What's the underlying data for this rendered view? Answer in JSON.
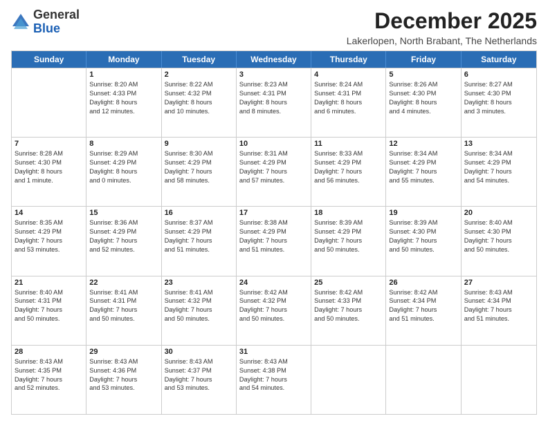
{
  "logo": {
    "general": "General",
    "blue": "Blue"
  },
  "title": "December 2025",
  "location": "Lakerlopen, North Brabant, The Netherlands",
  "header_days": [
    "Sunday",
    "Monday",
    "Tuesday",
    "Wednesday",
    "Thursday",
    "Friday",
    "Saturday"
  ],
  "weeks": [
    [
      {
        "empty": true
      },
      {
        "day": "1",
        "sunrise": "Sunrise: 8:20 AM",
        "sunset": "Sunset: 4:33 PM",
        "daylight": "Daylight: 8 hours",
        "minutes": "and 12 minutes."
      },
      {
        "day": "2",
        "sunrise": "Sunrise: 8:22 AM",
        "sunset": "Sunset: 4:32 PM",
        "daylight": "Daylight: 8 hours",
        "minutes": "and 10 minutes."
      },
      {
        "day": "3",
        "sunrise": "Sunrise: 8:23 AM",
        "sunset": "Sunset: 4:31 PM",
        "daylight": "Daylight: 8 hours",
        "minutes": "and 8 minutes."
      },
      {
        "day": "4",
        "sunrise": "Sunrise: 8:24 AM",
        "sunset": "Sunset: 4:31 PM",
        "daylight": "Daylight: 8 hours",
        "minutes": "and 6 minutes."
      },
      {
        "day": "5",
        "sunrise": "Sunrise: 8:26 AM",
        "sunset": "Sunset: 4:30 PM",
        "daylight": "Daylight: 8 hours",
        "minutes": "and 4 minutes."
      },
      {
        "day": "6",
        "sunrise": "Sunrise: 8:27 AM",
        "sunset": "Sunset: 4:30 PM",
        "daylight": "Daylight: 8 hours",
        "minutes": "and 3 minutes."
      }
    ],
    [
      {
        "day": "7",
        "sunrise": "Sunrise: 8:28 AM",
        "sunset": "Sunset: 4:30 PM",
        "daylight": "Daylight: 8 hours",
        "minutes": "and 1 minute."
      },
      {
        "day": "8",
        "sunrise": "Sunrise: 8:29 AM",
        "sunset": "Sunset: 4:29 PM",
        "daylight": "Daylight: 8 hours",
        "minutes": "and 0 minutes."
      },
      {
        "day": "9",
        "sunrise": "Sunrise: 8:30 AM",
        "sunset": "Sunset: 4:29 PM",
        "daylight": "Daylight: 7 hours",
        "minutes": "and 58 minutes."
      },
      {
        "day": "10",
        "sunrise": "Sunrise: 8:31 AM",
        "sunset": "Sunset: 4:29 PM",
        "daylight": "Daylight: 7 hours",
        "minutes": "and 57 minutes."
      },
      {
        "day": "11",
        "sunrise": "Sunrise: 8:33 AM",
        "sunset": "Sunset: 4:29 PM",
        "daylight": "Daylight: 7 hours",
        "minutes": "and 56 minutes."
      },
      {
        "day": "12",
        "sunrise": "Sunrise: 8:34 AM",
        "sunset": "Sunset: 4:29 PM",
        "daylight": "Daylight: 7 hours",
        "minutes": "and 55 minutes."
      },
      {
        "day": "13",
        "sunrise": "Sunrise: 8:34 AM",
        "sunset": "Sunset: 4:29 PM",
        "daylight": "Daylight: 7 hours",
        "minutes": "and 54 minutes."
      }
    ],
    [
      {
        "day": "14",
        "sunrise": "Sunrise: 8:35 AM",
        "sunset": "Sunset: 4:29 PM",
        "daylight": "Daylight: 7 hours",
        "minutes": "and 53 minutes."
      },
      {
        "day": "15",
        "sunrise": "Sunrise: 8:36 AM",
        "sunset": "Sunset: 4:29 PM",
        "daylight": "Daylight: 7 hours",
        "minutes": "and 52 minutes."
      },
      {
        "day": "16",
        "sunrise": "Sunrise: 8:37 AM",
        "sunset": "Sunset: 4:29 PM",
        "daylight": "Daylight: 7 hours",
        "minutes": "and 51 minutes."
      },
      {
        "day": "17",
        "sunrise": "Sunrise: 8:38 AM",
        "sunset": "Sunset: 4:29 PM",
        "daylight": "Daylight: 7 hours",
        "minutes": "and 51 minutes."
      },
      {
        "day": "18",
        "sunrise": "Sunrise: 8:39 AM",
        "sunset": "Sunset: 4:29 PM",
        "daylight": "Daylight: 7 hours",
        "minutes": "and 50 minutes."
      },
      {
        "day": "19",
        "sunrise": "Sunrise: 8:39 AM",
        "sunset": "Sunset: 4:30 PM",
        "daylight": "Daylight: 7 hours",
        "minutes": "and 50 minutes."
      },
      {
        "day": "20",
        "sunrise": "Sunrise: 8:40 AM",
        "sunset": "Sunset: 4:30 PM",
        "daylight": "Daylight: 7 hours",
        "minutes": "and 50 minutes."
      }
    ],
    [
      {
        "day": "21",
        "sunrise": "Sunrise: 8:40 AM",
        "sunset": "Sunset: 4:31 PM",
        "daylight": "Daylight: 7 hours",
        "minutes": "and 50 minutes."
      },
      {
        "day": "22",
        "sunrise": "Sunrise: 8:41 AM",
        "sunset": "Sunset: 4:31 PM",
        "daylight": "Daylight: 7 hours",
        "minutes": "and 50 minutes."
      },
      {
        "day": "23",
        "sunrise": "Sunrise: 8:41 AM",
        "sunset": "Sunset: 4:32 PM",
        "daylight": "Daylight: 7 hours",
        "minutes": "and 50 minutes."
      },
      {
        "day": "24",
        "sunrise": "Sunrise: 8:42 AM",
        "sunset": "Sunset: 4:32 PM",
        "daylight": "Daylight: 7 hours",
        "minutes": "and 50 minutes."
      },
      {
        "day": "25",
        "sunrise": "Sunrise: 8:42 AM",
        "sunset": "Sunset: 4:33 PM",
        "daylight": "Daylight: 7 hours",
        "minutes": "and 50 minutes."
      },
      {
        "day": "26",
        "sunrise": "Sunrise: 8:42 AM",
        "sunset": "Sunset: 4:34 PM",
        "daylight": "Daylight: 7 hours",
        "minutes": "and 51 minutes."
      },
      {
        "day": "27",
        "sunrise": "Sunrise: 8:43 AM",
        "sunset": "Sunset: 4:34 PM",
        "daylight": "Daylight: 7 hours",
        "minutes": "and 51 minutes."
      }
    ],
    [
      {
        "day": "28",
        "sunrise": "Sunrise: 8:43 AM",
        "sunset": "Sunset: 4:35 PM",
        "daylight": "Daylight: 7 hours",
        "minutes": "and 52 minutes."
      },
      {
        "day": "29",
        "sunrise": "Sunrise: 8:43 AM",
        "sunset": "Sunset: 4:36 PM",
        "daylight": "Daylight: 7 hours",
        "minutes": "and 53 minutes."
      },
      {
        "day": "30",
        "sunrise": "Sunrise: 8:43 AM",
        "sunset": "Sunset: 4:37 PM",
        "daylight": "Daylight: 7 hours",
        "minutes": "and 53 minutes."
      },
      {
        "day": "31",
        "sunrise": "Sunrise: 8:43 AM",
        "sunset": "Sunset: 4:38 PM",
        "daylight": "Daylight: 7 hours",
        "minutes": "and 54 minutes."
      },
      {
        "empty": true
      },
      {
        "empty": true
      },
      {
        "empty": true
      }
    ]
  ]
}
